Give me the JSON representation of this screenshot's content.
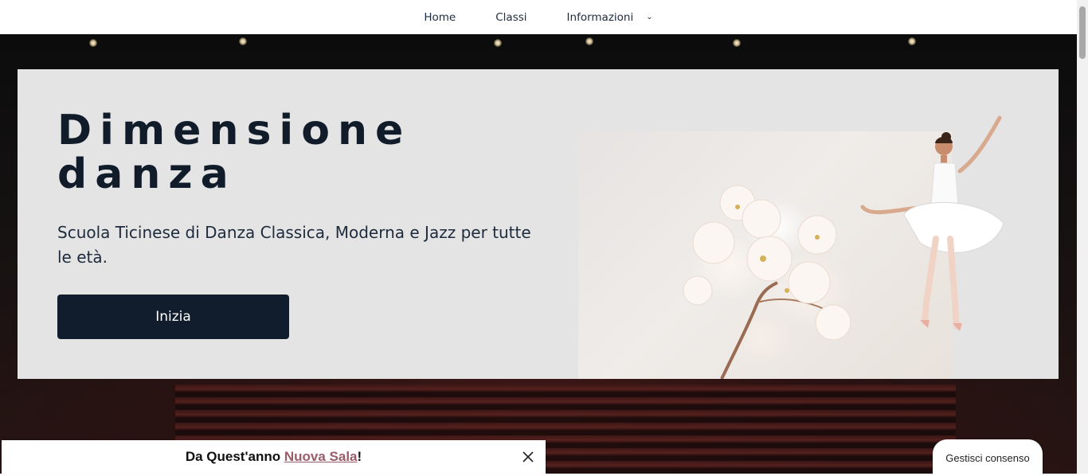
{
  "nav": {
    "items": [
      {
        "label": "Home"
      },
      {
        "label": "Classi"
      },
      {
        "label": "Informazioni"
      }
    ],
    "dropdown_icon": "⌄"
  },
  "hero": {
    "title": "Dimensione danza",
    "subtitle": "Scuola Ticinese di Danza Classica, Moderna e Jazz per tutte le età.",
    "cta_label": "Inizia"
  },
  "banner": {
    "prefix": "Da Quest'anno ",
    "link_text": "Nuova Sala",
    "suffix": "!",
    "close_icon": "close-icon"
  },
  "consent": {
    "label": "Gestisci consenso"
  },
  "colors": {
    "dark_navy": "#111d2c",
    "hero_bg": "#e4e4e4",
    "link_mauve": "#9b5c6a"
  }
}
